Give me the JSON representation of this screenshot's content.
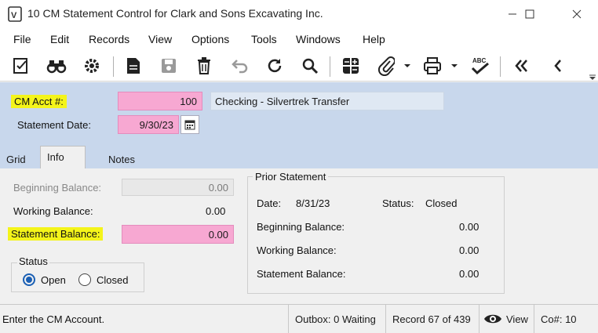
{
  "window": {
    "title": "10 CM Statement Control for Clark and Sons Excavating Inc.",
    "minimize_icon": "minimize-icon",
    "maximize_icon": "maximize-icon",
    "close_icon": "close-icon"
  },
  "menu": {
    "file": "File",
    "edit": "Edit",
    "records": "Records",
    "view": "View",
    "options": "Options",
    "tools": "Tools",
    "windows": "Windows",
    "help": "Help"
  },
  "toolbar": {
    "icons": [
      "checklist-icon",
      "binoculars-icon",
      "gear-icon",
      "document-icon",
      "save-icon",
      "delete-icon",
      "undo-icon",
      "refresh-icon",
      "search-icon",
      "calculator-icon",
      "attachment-icon",
      "print-icon",
      "spellcheck-icon",
      "first-record-icon",
      "previous-record-icon"
    ],
    "spellcheck_text": "ABC"
  },
  "header": {
    "cm_acct_label": "CM Acct #:",
    "cm_acct_value": "100",
    "cm_acct_desc": "Checking - Silvertrek Transfer",
    "statement_date_label": "Statement Date:",
    "statement_date_value": "9/30/23"
  },
  "tabs": {
    "grid": "Grid",
    "info": "Info",
    "notes": "Notes"
  },
  "info": {
    "beginning_balance_label": "Beginning Balance:",
    "beginning_balance_value": "0.00",
    "working_balance_label": "Working Balance:",
    "working_balance_value": "0.00",
    "statement_balance_label": "Statement Balance:",
    "statement_balance_value": "0.00",
    "status_group_label": "Status",
    "status_open": "Open",
    "status_closed": "Closed",
    "status_selected": "Open"
  },
  "prior": {
    "group_label": "Prior Statement",
    "date_label": "Date:",
    "date_value": "8/31/23",
    "status_label": "Status:",
    "status_value": "Closed",
    "beginning_balance_label": "Beginning Balance:",
    "beginning_balance_value": "0.00",
    "working_balance_label": "Working Balance:",
    "working_balance_value": "0.00",
    "statement_balance_label": "Statement Balance:",
    "statement_balance_value": "0.00"
  },
  "statusbar": {
    "message": "Enter the CM Account.",
    "outbox": "Outbox: 0 Waiting",
    "record": "Record 67 of 439",
    "view": "View",
    "company": "Co#: 10"
  },
  "colors": {
    "required_field": "#f7a8d2",
    "highlight": "#f4f41a",
    "header_bg": "#c8d7ec",
    "radio_accent": "#1a5fb4"
  }
}
